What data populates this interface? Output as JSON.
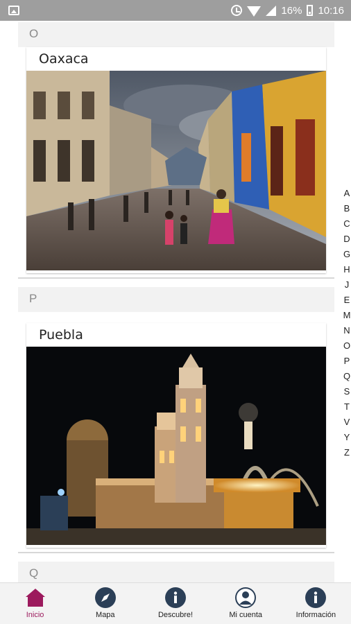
{
  "status_bar": {
    "battery": "16%",
    "time": "10:16"
  },
  "sections": [
    {
      "letter": "O",
      "city": "Oaxaca"
    },
    {
      "letter": "P",
      "city": "Puebla"
    },
    {
      "letter": "Q"
    }
  ],
  "alphabet_index": [
    "A",
    "B",
    "C",
    "D",
    "G",
    "H",
    "J",
    "E",
    "M",
    "N",
    "O",
    "P",
    "Q",
    "S",
    "T",
    "V",
    "Y",
    "Z"
  ],
  "bottom_nav": [
    {
      "label": "Inicio",
      "icon": "home-icon",
      "active": true
    },
    {
      "label": "Mapa",
      "icon": "compass-icon"
    },
    {
      "label": "Descubre!",
      "icon": "info-icon"
    },
    {
      "label": "Mi cuenta",
      "icon": "account-icon"
    },
    {
      "label": "Información",
      "icon": "info-icon"
    }
  ],
  "colors": {
    "accent": "#9c1a5d",
    "nav_icon": "#2b3f57",
    "status_bar": "#9e9e9e"
  }
}
